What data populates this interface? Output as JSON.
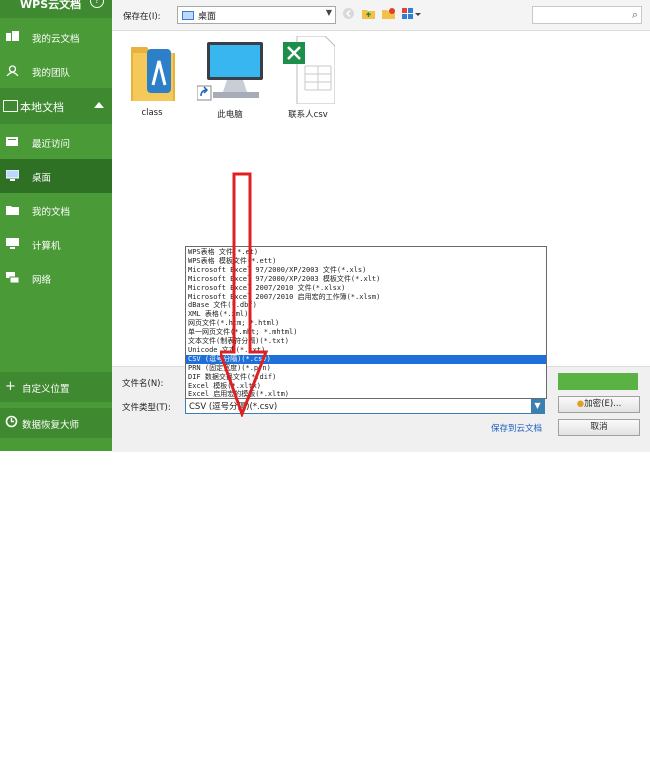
{
  "sidebar": {
    "app_title": "WPS云文档",
    "help_icon": "?",
    "items": [
      {
        "label": "我的云文档",
        "icon": "cloud-doc-icon"
      },
      {
        "label": "我的团队",
        "icon": "team-icon"
      }
    ],
    "section": {
      "label": "本地文档",
      "icon": "monitor-icon"
    },
    "local_items": [
      {
        "label": "最近访问",
        "icon": "recent-icon"
      },
      {
        "label": "桌面",
        "icon": "desktop-icon"
      },
      {
        "label": "我的文档",
        "icon": "folder-icon"
      },
      {
        "label": "计算机",
        "icon": "computer-icon"
      },
      {
        "label": "网络",
        "icon": "network-icon"
      }
    ],
    "bottom_buttons": [
      {
        "label": "自定义位置",
        "icon": "plus-icon"
      },
      {
        "label": "数据恢复大师",
        "icon": "recovery-icon"
      }
    ]
  },
  "toolbar": {
    "save_in_label": "保存在(I):",
    "location": "桌面",
    "search_placeholder": ""
  },
  "files": [
    {
      "name": "class",
      "icon": "folder-icon"
    },
    {
      "name": "此电脑",
      "icon": "computer-shortcut-icon"
    },
    {
      "name": "联系人csv",
      "icon": "excel-file-icon"
    }
  ],
  "bottom": {
    "file_name_label": "文件名(N):",
    "file_name_value": "",
    "file_type_label": "文件类型(T):",
    "file_type_value": "CSV (逗号分隔)(*.csv)",
    "encrypt_button": "加密(E)...",
    "cancel_button": "取消",
    "save_cloud_link": "保存到云文档"
  },
  "dropdown_options": [
    "WPS表格 文件(*.et)",
    "WPS表格 模板文件(*.ett)",
    "Microsoft Excel 97/2000/XP/2003 文件(*.xls)",
    "Microsoft Excel 97/2000/XP/2003 模板文件(*.xlt)",
    "Microsoft Excel 2007/2010 文件(*.xlsx)",
    "Microsoft Excel 2007/2010 启用宏的工作簿(*.xlsm)",
    "dBase 文件(*.dbf)",
    "XML 表格(*.xml)",
    "网页文件(*.htm; *.html)",
    "单一网页文件(*.mht; *.mhtml)",
    "文本文件(制表符分隔)(*.txt)",
    "Unicode 文本(*.txt)",
    "CSV (逗号分隔)(*.csv)",
    "PRN (固定宽度)(*.prn)",
    "DIF 数据交换文件(*.dif)",
    "Excel 模板(*.xltx)",
    "Excel 启用宏的模板(*.xltm)"
  ],
  "selected_option_index": 12,
  "colors": {
    "sidebar": "#4a9a38",
    "selection": "#1e6fd9",
    "arrow": "#e02020"
  }
}
